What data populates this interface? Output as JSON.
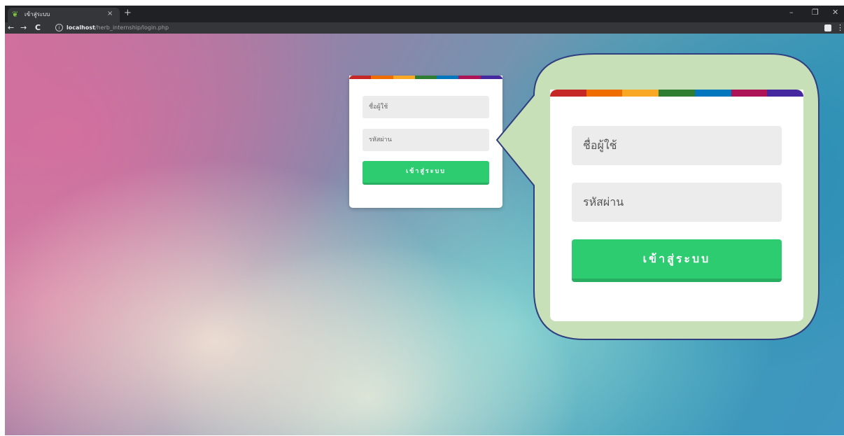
{
  "browser": {
    "tab_title": "เข้าสู่ระบบ",
    "tab_close": "×",
    "new_tab": "+",
    "minimize": "–",
    "maximize": "❐",
    "close": "✕",
    "back": "←",
    "forward": "→",
    "reload": "C",
    "info": "i",
    "url_host": "localhost",
    "url_path": "/herb_internship/login.php",
    "menu": "⋮"
  },
  "login": {
    "stripe_colors": [
      "#c62828",
      "#ef6c00",
      "#f9a825",
      "#2e7d32",
      "#0277bd",
      "#ad1457",
      "#4527a0"
    ],
    "username_placeholder": "ชื่อผู้ใช้",
    "password_placeholder": "รหัสผ่าน",
    "submit_label": "เข้าสู่ระบบ"
  },
  "zoom": {
    "username_placeholder": "ชื่อผู้ใช้",
    "password_placeholder": "รหัสผ่าน",
    "submit_label": "เข้าสู่ระบบ"
  },
  "colors": {
    "button": "#2ecc71",
    "callout_fill": "#c8e0b8",
    "callout_border": "#2f3f7f"
  }
}
